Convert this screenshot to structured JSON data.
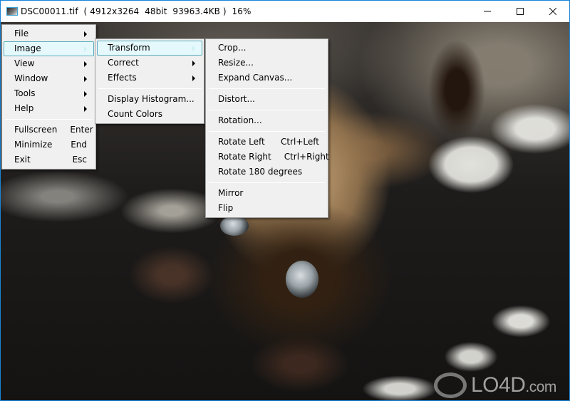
{
  "window": {
    "title": "DSC00011.tif  ( 4912x3264  48bit  93963.4KB )  16%",
    "app_icon": "image-file-icon",
    "controls": {
      "minimize": "minimize-icon",
      "maximize": "maximize-icon",
      "close": "close-icon"
    },
    "border_color": "#1883d7"
  },
  "main_menu": {
    "items": [
      {
        "label": "File",
        "submenu": true
      },
      {
        "label": "Image",
        "submenu": true,
        "active": true
      },
      {
        "label": "View",
        "submenu": true
      },
      {
        "label": "Window",
        "submenu": true
      },
      {
        "label": "Tools",
        "submenu": true
      },
      {
        "label": "Help",
        "submenu": true
      }
    ],
    "commands": [
      {
        "label": "Fullscreen",
        "shortcut": "Enter"
      },
      {
        "label": "Minimize",
        "shortcut": "End"
      },
      {
        "label": "Exit",
        "shortcut": "Esc"
      }
    ]
  },
  "image_menu": {
    "items": [
      {
        "label": "Transform",
        "submenu": true,
        "active": true
      },
      {
        "label": "Correct",
        "submenu": true
      },
      {
        "label": "Effects",
        "submenu": true
      }
    ],
    "commands": [
      {
        "label": "Display Histogram..."
      },
      {
        "label": "Count Colors"
      }
    ]
  },
  "transform_menu": {
    "group1": [
      {
        "label": "Crop..."
      },
      {
        "label": "Resize..."
      },
      {
        "label": "Expand Canvas..."
      }
    ],
    "group2": [
      {
        "label": "Distort..."
      }
    ],
    "group3": [
      {
        "label": "Rotation..."
      }
    ],
    "group4": [
      {
        "label": "Rotate Left",
        "shortcut": "Ctrl+Left"
      },
      {
        "label": "Rotate Right",
        "shortcut": "Ctrl+Right"
      },
      {
        "label": "Rotate 180 degrees"
      }
    ],
    "group5": [
      {
        "label": "Mirror"
      },
      {
        "label": "Flip"
      }
    ]
  },
  "canvas": {
    "content": "photo of a Siamese cat lying upside down on a black and white striped blanket"
  },
  "watermark": {
    "brand": "LO4D",
    "suffix": ".com"
  },
  "colors": {
    "menu_bg": "#f0f0f0",
    "menu_highlight_bg": "#e5f9fc",
    "menu_highlight_border": "#59adbd"
  }
}
